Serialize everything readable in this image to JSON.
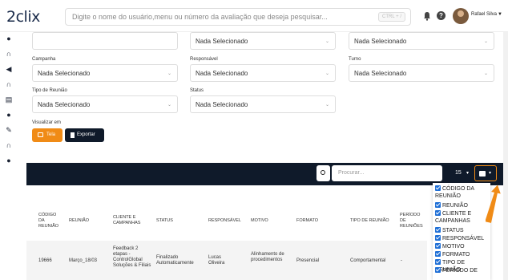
{
  "header": {
    "logo": "2clix",
    "search_placeholder": "Digite o nome do usuário,menu ou número da avaliação que deseja pesquisar...",
    "shortcut": "CTRL + /",
    "user_name": "Rafael Silva"
  },
  "filters": {
    "top_row": [
      {
        "label": "",
        "value": ""
      },
      {
        "label": "",
        "value": "Nada Selecionado"
      },
      {
        "label": "",
        "value": "Nada Selecionado"
      }
    ],
    "campanha": {
      "label": "Campanha",
      "value": "Nada Selecionado"
    },
    "responsavel": {
      "label": "Responsável",
      "value": "Nada Selecionado"
    },
    "turno": {
      "label": "Turno",
      "value": "Nada Selecionado"
    },
    "tipo_reuniao": {
      "label": "Tipo de Reunião",
      "value": "Nada Selecionado"
    },
    "status": {
      "label": "Status",
      "value": "Nada Selecionado"
    }
  },
  "view": {
    "label": "Visualizar em",
    "tela_label": "Tela",
    "export_label": "Exportar"
  },
  "table": {
    "search_placeholder": "Procurar...",
    "per_page": "15",
    "headers": [
      "CÓDIGO DA REUNIÃO",
      "REUNIÃO",
      "CLIENTE E CAMPANHAS",
      "STATUS",
      "RESPONSÁVEL",
      "MOTIVO",
      "FORMATO",
      "TIPO DE REUNIÃO",
      "PERÍODO DE REUNIÕES"
    ],
    "rows": [
      {
        "codigo": "19666",
        "reuniao": "Março_18/03",
        "cliente": "Feedback 2 etapas - ControlGlobal Soluções & Filiais",
        "status": "Finalizado Automaticamente",
        "responsavel": "Lucas Oliveira",
        "motivo": "Alinhamento de procedimentos",
        "formato": "Presencial",
        "tipo": "Comportamental",
        "periodo": "-"
      }
    ]
  },
  "column_menu": {
    "items": [
      "CÓDIGO DA REUNIÃO",
      "REUNIÃO",
      "CLIENTE E CAMPANHAS",
      "STATUS",
      "RESPONSÁVEL",
      "MOTIVO",
      "FORMATO",
      "TIPO DE REUNIÃO",
      "PERÍODO DE"
    ]
  },
  "colors": {
    "accent": "#f08b16",
    "dark": "#0f1a2a",
    "checkbox": "#1f6fd6"
  }
}
